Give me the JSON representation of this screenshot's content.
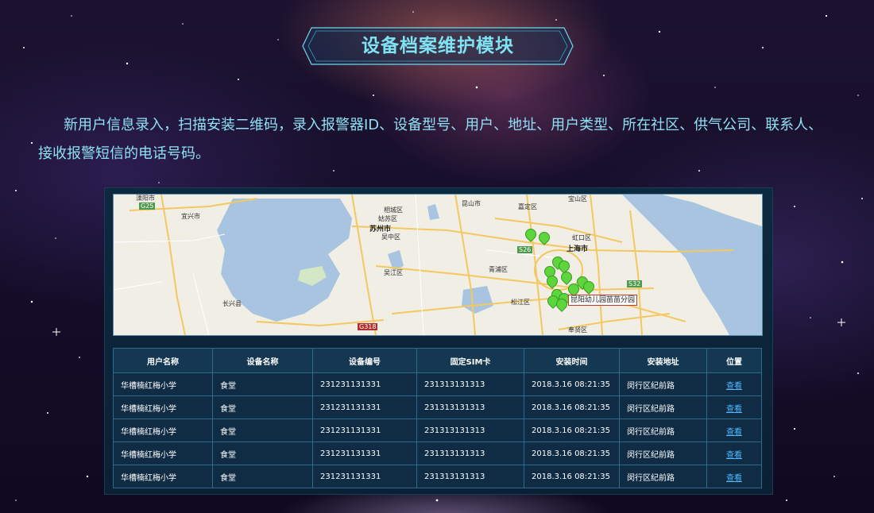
{
  "header": {
    "title": "设备档案维护模块"
  },
  "description": "新用户信息录入，扫描安装二维码，录入报警器ID、设备型号、用户、地址、用户类型、所在社区、供气公司、联系人、接收报警短信的电话号码。",
  "map": {
    "labels": {
      "changzhou": "溧阳市",
      "yixing": "宜兴市",
      "xiangcheng": "相城区",
      "gusu": "姑苏区",
      "suzhou": "苏州市",
      "wuzhong": "吴中区",
      "wujiang": "吴江区",
      "changxing": "长兴县",
      "kunshan": "昆山市",
      "jiading": "嘉定区",
      "baoshan": "宝山区",
      "hongkou": "虹口区",
      "shanghai": "上海市",
      "qingpu": "青浦区",
      "songjiang": "松江区",
      "fengxian": "奉贤区",
      "g25": "G25",
      "g318": "G318",
      "s26": "S26",
      "s32": "S32"
    },
    "popup": "昆阳幼儿园苗苗分园"
  },
  "table": {
    "headers": [
      "用户名称",
      "设备名称",
      "设备编号",
      "固定SIM卡",
      "安装时间",
      "安装地址",
      "位置"
    ],
    "rows": [
      [
        "华槽楠红梅小学",
        "食堂",
        "231231131331",
        "231313131313",
        "2018.3.16 08:21:35",
        "闵行区纪前路",
        "查看"
      ],
      [
        "华槽楠红梅小学",
        "食堂",
        "231231131331",
        "231313131313",
        "2018.3.16 08:21:35",
        "闵行区纪前路",
        "查看"
      ],
      [
        "华槽楠红梅小学",
        "食堂",
        "231231131331",
        "231313131313",
        "2018.3.16 08:21:35",
        "闵行区纪前路",
        "查看"
      ],
      [
        "华槽楠红梅小学",
        "食堂",
        "231231131331",
        "231313131313",
        "2018.3.16 08:21:35",
        "闵行区纪前路",
        "查看"
      ],
      [
        "华槽楠红梅小学",
        "食堂",
        "231231131331",
        "231313131313",
        "2018.3.16 08:21:35",
        "闵行区纪前路",
        "查看"
      ]
    ]
  },
  "colors": {
    "accent": "#7fe2f2",
    "link": "#4fb7ff",
    "pin": "#5cd63c"
  }
}
